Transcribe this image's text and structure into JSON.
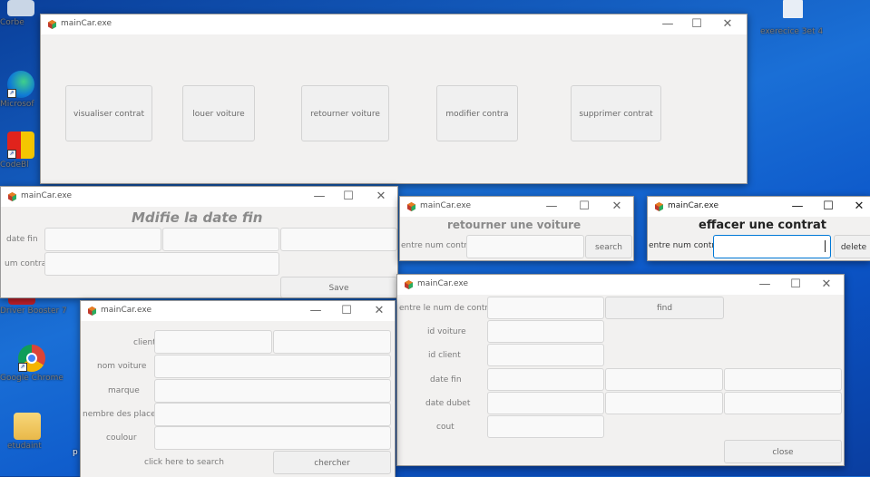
{
  "app_title": "mainCar.exe",
  "desktop": {
    "icons": [
      {
        "name": "recycle-bin",
        "label": "Corbe"
      },
      {
        "name": "edge",
        "label": "Microsof"
      },
      {
        "name": "codeblocks",
        "label": "CodeBl"
      },
      {
        "name": "driver-booster",
        "label": "Driver Booster 7"
      },
      {
        "name": "google-chrome",
        "label": "Google Chrome"
      },
      {
        "name": "etudaint-folder",
        "label": "etudaint"
      },
      {
        "name": "exercice-file",
        "label": "exerecice 3et 4"
      }
    ],
    "partial_label": "p"
  },
  "main_menu": {
    "buttons": [
      "visualiser contrat",
      "louer voiture",
      "retourner voiture",
      "modifier contra",
      "supprimer contrat"
    ]
  },
  "modify_date": {
    "heading": "Mdifie la date fin",
    "date_fin_label": "date fin",
    "num_contrat_label": "um contra",
    "save_label": "Save"
  },
  "return_car": {
    "heading": "retourner une voiture",
    "num_label": "entre num contra",
    "search_label": "search"
  },
  "delete_contract": {
    "heading": "effacer une contrat",
    "num_label": "entre num contra",
    "input_value": "",
    "delete_label": "delete"
  },
  "find_contract": {
    "num_label": "entre le num de contra",
    "find_label": "find",
    "fields": [
      "id voiture",
      "id client",
      "date fin",
      "date dubet",
      "cout"
    ],
    "close_label": "close"
  },
  "search_car": {
    "fields": [
      "client",
      "nom voiture",
      "marque",
      "nembre des places",
      "coulour"
    ],
    "hint": "click here to search",
    "search_label": "chercher"
  },
  "window_controls": {
    "minimize": "—",
    "maximize": "☐",
    "close": "✕"
  },
  "colors": {
    "accent_focus": "#0078d7",
    "window_bg": "#f2f1f0",
    "titlebar": "#ffffff"
  }
}
